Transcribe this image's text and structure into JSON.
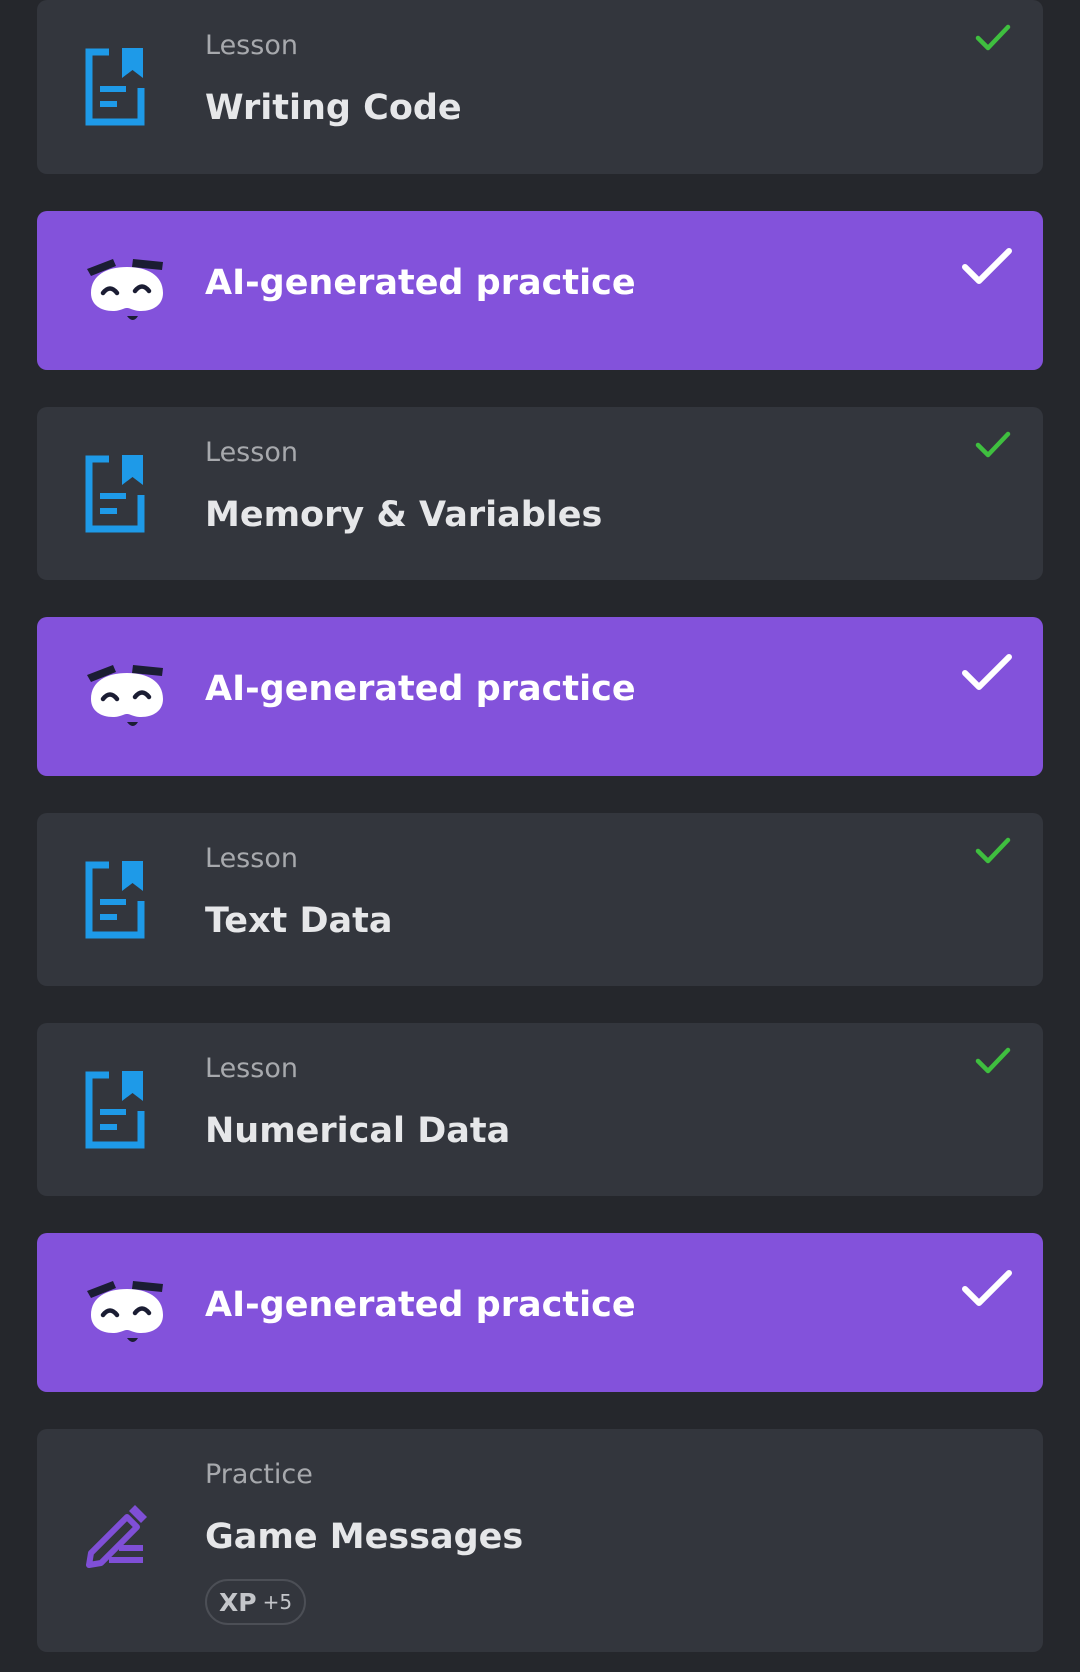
{
  "colors": {
    "background": "#25272c",
    "card": "#33363d",
    "ai_card": "#8352db",
    "lesson_icon": "#1e9ae8",
    "practice_icon": "#7f4fd6",
    "check_green": "#3fbf3f",
    "check_white": "#ffffff"
  },
  "items": [
    {
      "type": "lesson",
      "subtitle": "Lesson",
      "title": "Writing Code",
      "icon": "document-bookmark-icon",
      "completed": true
    },
    {
      "type": "ai",
      "title": "AI-generated practice",
      "icon": "ai-mascot-icon",
      "completed": true
    },
    {
      "type": "lesson",
      "subtitle": "Lesson",
      "title": "Memory & Variables",
      "icon": "document-bookmark-icon",
      "completed": true
    },
    {
      "type": "ai",
      "title": "AI-generated practice",
      "icon": "ai-mascot-icon",
      "completed": true
    },
    {
      "type": "lesson",
      "subtitle": "Lesson",
      "title": "Text Data",
      "icon": "document-bookmark-icon",
      "completed": true
    },
    {
      "type": "lesson",
      "subtitle": "Lesson",
      "title": "Numerical Data",
      "icon": "document-bookmark-icon",
      "completed": true
    },
    {
      "type": "ai",
      "title": "AI-generated practice",
      "icon": "ai-mascot-icon",
      "completed": true
    },
    {
      "type": "practice",
      "subtitle": "Practice",
      "title": "Game Messages",
      "icon": "pencil-icon",
      "xp_label": "XP",
      "xp_value": "+5",
      "completed": false
    }
  ]
}
